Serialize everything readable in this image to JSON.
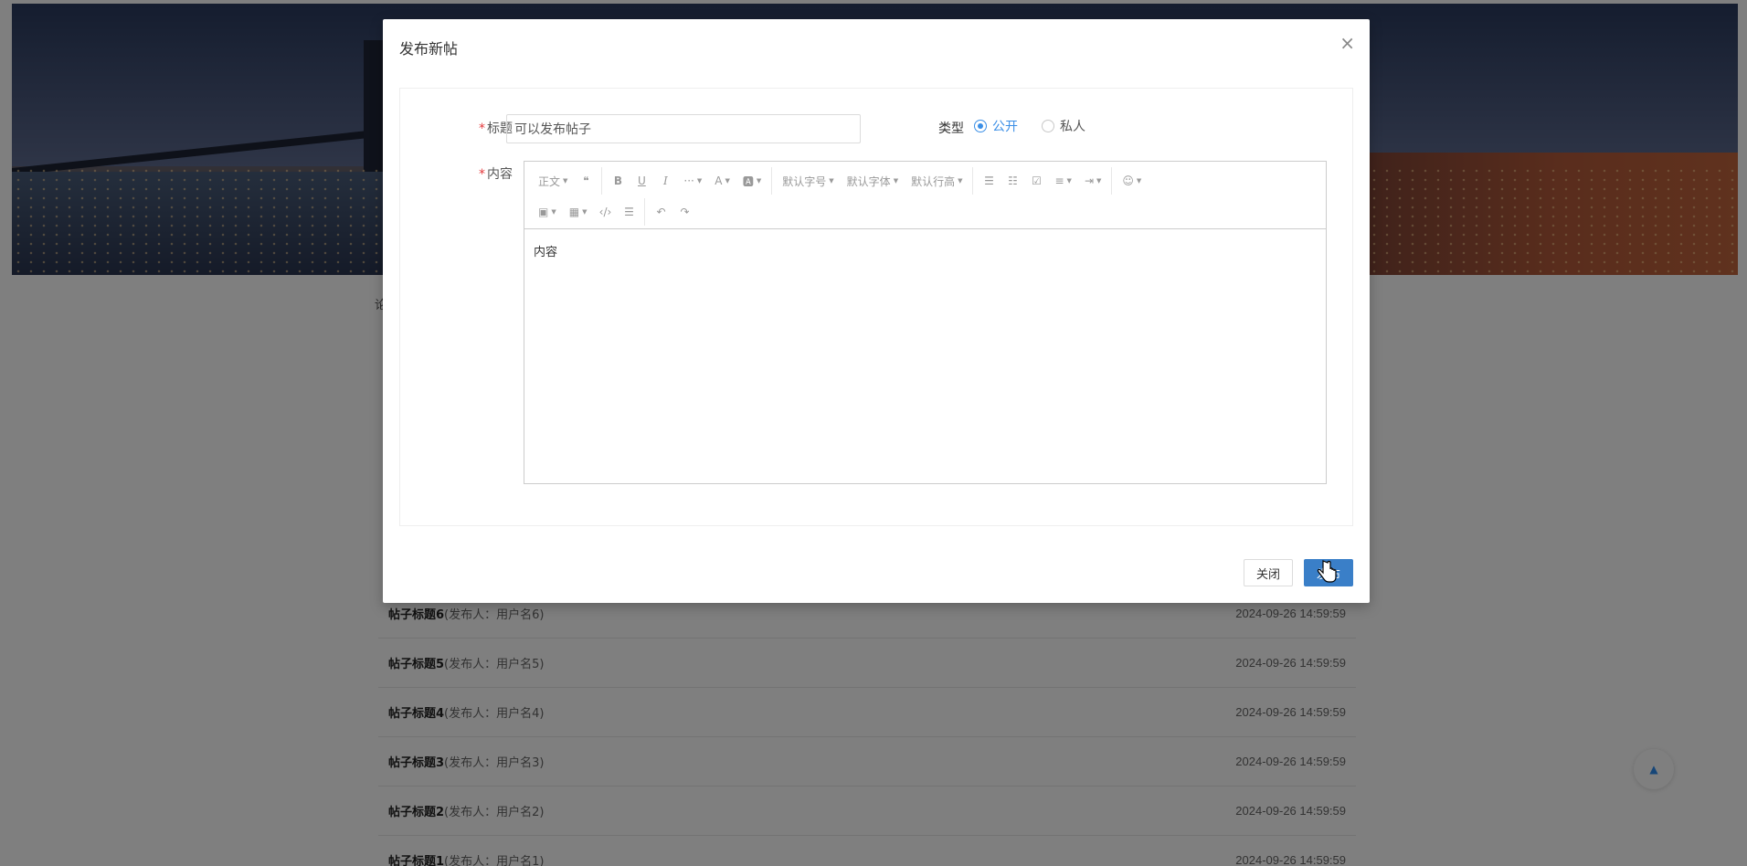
{
  "background": {
    "section_stub": "论",
    "posts": [
      {
        "title": "帖子标题6",
        "author": "(发布人：用户名6)",
        "date": "2024-09-26 14:59:59"
      },
      {
        "title": "帖子标题5",
        "author": "(发布人：用户名5)",
        "date": "2024-09-26 14:59:59"
      },
      {
        "title": "帖子标题4",
        "author": "(发布人：用户名4)",
        "date": "2024-09-26 14:59:59"
      },
      {
        "title": "帖子标题3",
        "author": "(发布人：用户名3)",
        "date": "2024-09-26 14:59:59"
      },
      {
        "title": "帖子标题2",
        "author": "(发布人：用户名2)",
        "date": "2024-09-26 14:59:59"
      },
      {
        "title": "帖子标题1",
        "author": "(发布人：用户名1)",
        "date": "2024-09-26 14:59:59"
      }
    ]
  },
  "modal": {
    "title": "发布新帖",
    "close_icon": "×",
    "form": {
      "title_label": "标题",
      "title_value": "可以发布帖子",
      "type_label": "类型",
      "type_options": [
        {
          "label": "公开",
          "checked": true
        },
        {
          "label": "私人",
          "checked": false
        }
      ],
      "content_label": "内容",
      "required_mark": "*"
    },
    "editor": {
      "toolbar_row1": [
        {
          "name": "paragraph-dropdown",
          "label": "正文",
          "caret": true
        },
        {
          "name": "quote-button",
          "label": "❝",
          "caret": false
        },
        {
          "name": "bold-button",
          "label": "B",
          "caret": false
        },
        {
          "name": "underline-button",
          "label": "U",
          "caret": false
        },
        {
          "name": "italic-button",
          "label": "I",
          "caret": false
        },
        {
          "name": "more-button",
          "label": "···",
          "caret": true
        },
        {
          "name": "font-color-button",
          "label": "A",
          "caret": true
        },
        {
          "name": "bg-color-button",
          "label": "🅰",
          "caret": true
        },
        {
          "name": "font-size-dropdown",
          "label": "默认字号",
          "caret": true
        },
        {
          "name": "font-family-dropdown",
          "label": "默认字体",
          "caret": true
        },
        {
          "name": "line-height-dropdown",
          "label": "默认行高",
          "caret": true
        },
        {
          "name": "bulleted-list-button",
          "label": "☰",
          "caret": false
        },
        {
          "name": "numbered-list-button",
          "label": "☷",
          "caret": false
        },
        {
          "name": "todo-button",
          "label": "☑",
          "caret": false
        },
        {
          "name": "align-button",
          "label": "≡",
          "caret": true
        },
        {
          "name": "indent-button",
          "label": "⇥",
          "caret": true
        },
        {
          "name": "emoji-button",
          "label": "☺",
          "caret": true
        }
      ],
      "toolbar_row2": [
        {
          "name": "image-button",
          "label": "▣",
          "caret": true
        },
        {
          "name": "table-button",
          "label": "▦",
          "caret": true
        },
        {
          "name": "code-button",
          "label": "‹/›",
          "caret": false
        },
        {
          "name": "divider-button",
          "label": "☰",
          "caret": false
        },
        {
          "name": "undo-button",
          "label": "↶",
          "caret": false
        },
        {
          "name": "redo-button",
          "label": "↷",
          "caret": false
        }
      ],
      "content": "内容"
    },
    "buttons": {
      "close": "关闭",
      "publish": "发布"
    }
  },
  "back_to_top_icon": "▲"
}
